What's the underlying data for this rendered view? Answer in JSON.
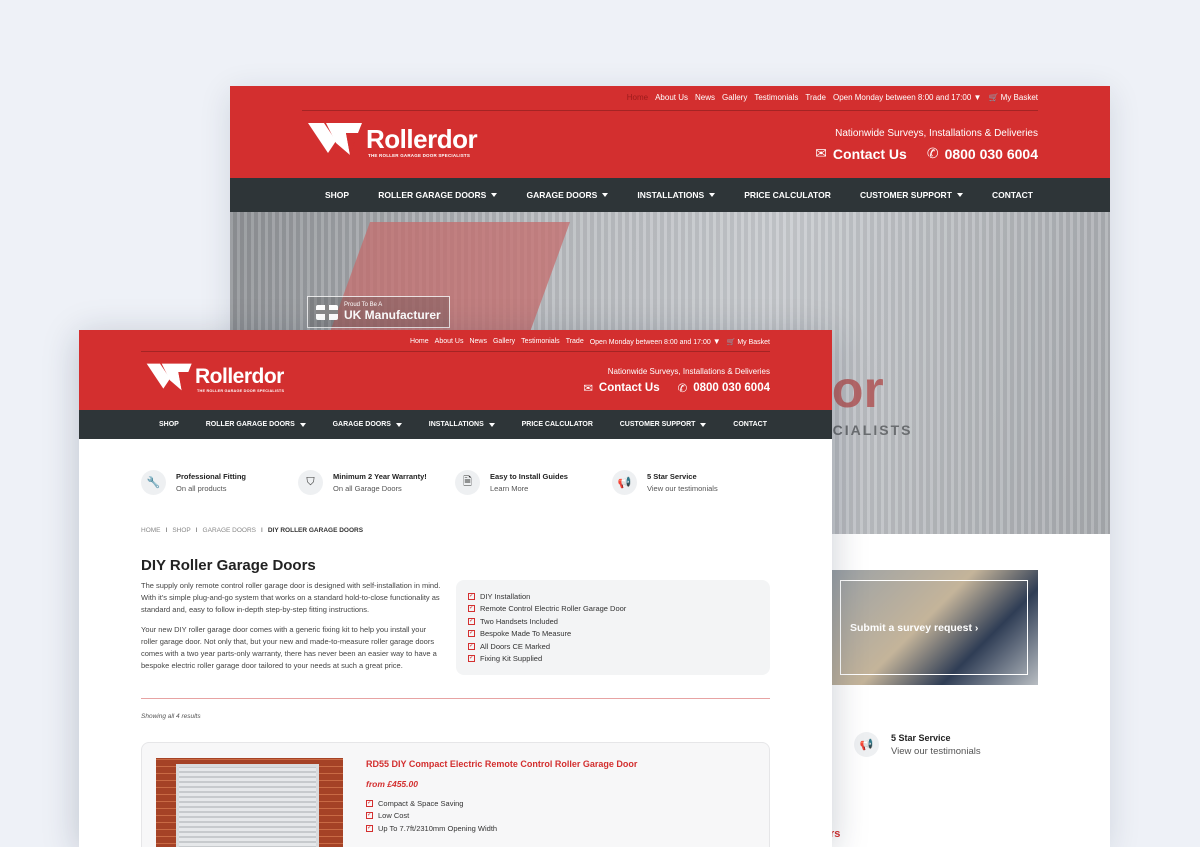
{
  "top_nav": {
    "home": "Home",
    "about": "About Us",
    "news": "News",
    "gallery": "Gallery",
    "testimonials": "Testimonials",
    "trade": "Trade",
    "hours": "Open Monday between 8:00 and 17:00",
    "basket": "My Basket"
  },
  "brand": {
    "logo_roller": "Roller",
    "logo_dor": "dor",
    "tagline": "THE ROLLER GARAGE DOOR SPECIALISTS",
    "accent_color": "#d32f2f",
    "nav_bg_color": "#2e3538"
  },
  "header": {
    "surveys": "Nationwide Surveys, Installations & Deliveries",
    "contact": "Contact Us",
    "phone": "0800 030 6004"
  },
  "main_nav": {
    "shop": "SHOP",
    "roller": "ROLLER GARAGE DOORS",
    "garage": "GARAGE DOORS",
    "installations": "INSTALLATIONS",
    "calculator": "PRICE CALCULATOR",
    "support": "CUSTOMER SUPPORT",
    "contact": "CONTACT"
  },
  "hero": {
    "badge_small": "Proud To Be A",
    "badge_big": "UK Manufacturer",
    "wall_word": "dor",
    "wall_sub": "PECIALISTS"
  },
  "survey_card": {
    "label": "Submit a survey request"
  },
  "back_features": {
    "star_title": "5 Star Service",
    "star_sub": "View our testimonials",
    "partial_heading": "rs"
  },
  "features": [
    {
      "title": "Professional Fitting",
      "sub": "On all products",
      "icon": "wrench-icon"
    },
    {
      "title": "Minimum 2 Year Warranty!",
      "sub": "On all Garage Doors",
      "icon": "shield-icon"
    },
    {
      "title": "Easy to Install Guides",
      "sub": "Learn More",
      "icon": "document-icon"
    },
    {
      "title": "5 Star Service",
      "sub": "View our testimonials",
      "icon": "megaphone-icon"
    }
  ],
  "breadcrumb": {
    "home": "HOME",
    "shop": "SHOP",
    "garage": "GARAGE DOORS",
    "current": "DIY ROLLER GARAGE DOORS"
  },
  "page": {
    "title": "DIY Roller Garage Doors",
    "para1": "The supply only remote control roller garage door is designed with self-installation in mind. With it's simple plug-and-go system that works on a standard hold-to-close functionality as standard and, easy to follow in-depth step-by-step fitting instructions.",
    "para2": "Your new DIY roller garage door comes with a generic fixing kit to help you install your roller garage door. Not only that, but your new and made-to-measure roller garage doors comes with a two year parts-only warranty, there has never been an easier way to have a bespoke electric roller garage door tailored to your needs at such a great price.",
    "results": "Showing all 4 results"
  },
  "feature_list": [
    "DIY Installation",
    "Remote Control Electric Roller Garage Door",
    "Two Handsets Included",
    "Bespoke Made To Measure",
    "All Doors CE Marked",
    "Fixing Kit Supplied"
  ],
  "product": {
    "name": "RD55 DIY Compact Electric Remote Control Roller Garage Door",
    "price": "from £455.00",
    "bullets": [
      "Compact & Space Saving",
      "Low Cost",
      "Up To 7.7ft/2310mm Opening Width"
    ]
  }
}
